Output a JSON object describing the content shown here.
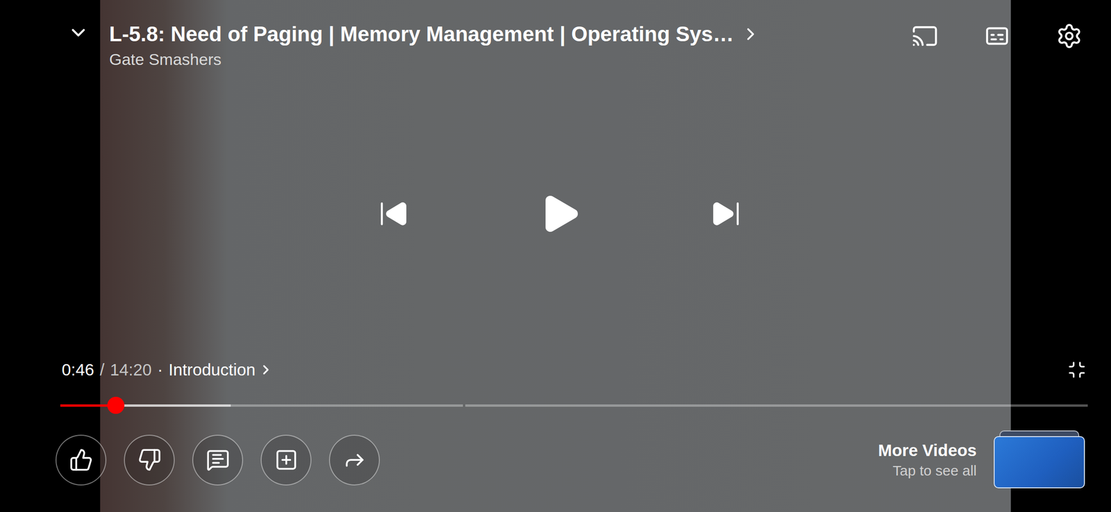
{
  "video": {
    "title": "L-5.8: Need of Paging | Memory Management | Operating Sys…",
    "channel": "Gate Smashers",
    "paused": true
  },
  "player": {
    "current_time": "0:46",
    "separator": "/",
    "duration": "14:20",
    "dot": "·",
    "chapter": "Introduction",
    "progress": {
      "level": 0.054,
      "buffered": 0.166,
      "chapters": [
        0.393,
        0.607
      ]
    }
  },
  "more_videos": {
    "title": "More Videos",
    "subtitle": "Tap to see all"
  }
}
